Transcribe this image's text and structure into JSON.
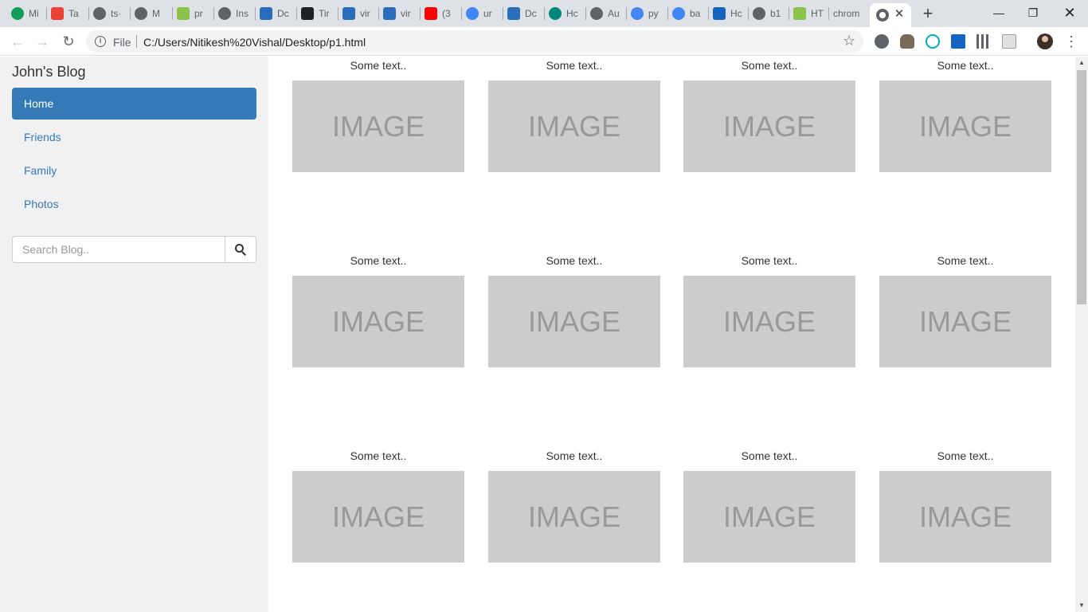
{
  "browser": {
    "tabs": [
      {
        "label": "Mi",
        "favicon_color": "#0f9d58",
        "icon": "hangouts-icon"
      },
      {
        "label": "Ta",
        "favicon_color": "#ea4335",
        "icon": "gmail-icon"
      },
      {
        "label": "ts·",
        "favicon_color": "#5f6368",
        "icon": "globe-icon"
      },
      {
        "label": "M",
        "favicon_color": "#5f6368",
        "icon": "globe-icon"
      },
      {
        "label": "pr",
        "favicon_color": "#8bc34a",
        "icon": "m-icon"
      },
      {
        "label": "Ins",
        "favicon_color": "#5f6368",
        "icon": "globe-icon"
      },
      {
        "label": "Dc",
        "favicon_color": "#2a6ebb",
        "icon": "doc-site-icon"
      },
      {
        "label": "Tir",
        "favicon_color": "#202124",
        "icon": "wikipedia-icon"
      },
      {
        "label": "vir",
        "favicon_color": "#2a6ebb",
        "icon": "doc-site-icon"
      },
      {
        "label": "vir",
        "favicon_color": "#2a6ebb",
        "icon": "doc-site-icon"
      },
      {
        "label": "(3",
        "favicon_color": "#ff0000",
        "icon": "youtube-icon"
      },
      {
        "label": "ur",
        "favicon_color": "#4285f4",
        "icon": "google-icon"
      },
      {
        "label": "Dc",
        "favicon_color": "#2a6ebb",
        "icon": "doc-site-icon"
      },
      {
        "label": "Hc",
        "favicon_color": "#00897b",
        "icon": "gear-site-icon"
      },
      {
        "label": "Au",
        "favicon_color": "#5f6368",
        "icon": "globe-icon"
      },
      {
        "label": "py",
        "favicon_color": "#4285f4",
        "icon": "google-icon"
      },
      {
        "label": "ba",
        "favicon_color": "#4285f4",
        "icon": "google-icon"
      },
      {
        "label": "Hc",
        "favicon_color": "#1565c0",
        "icon": "bootstrap-icon"
      },
      {
        "label": "b1",
        "favicon_color": "#5f6368",
        "icon": "globe-icon"
      },
      {
        "label": "HT",
        "favicon_color": "#8bc34a",
        "icon": "w3-icon"
      },
      {
        "label": "chrom",
        "favicon_color": "",
        "icon": ""
      }
    ],
    "address": {
      "scheme": "File",
      "url": "C:/Users/Nitikesh%20Vishal/Desktop/p1.html"
    }
  },
  "page": {
    "blog_title": "John's Blog",
    "nav": [
      "Home",
      "Friends",
      "Family",
      "Photos"
    ],
    "active_nav": "Home",
    "search": {
      "placeholder": "Search Blog..",
      "value": ""
    },
    "gallery": [
      [
        "Some text..",
        "Some text..",
        "Some text..",
        "Some text.."
      ],
      [
        "Some text..",
        "Some text..",
        "Some text..",
        "Some text.."
      ],
      [
        "Some text..",
        "Some text..",
        "Some text..",
        "Some text.."
      ]
    ],
    "placeholder_text": "IMAGE"
  },
  "colors": {
    "accent": "#337ab7",
    "sidebar_bg": "#f1f1f1",
    "placeholder_bg": "#cccccc"
  }
}
